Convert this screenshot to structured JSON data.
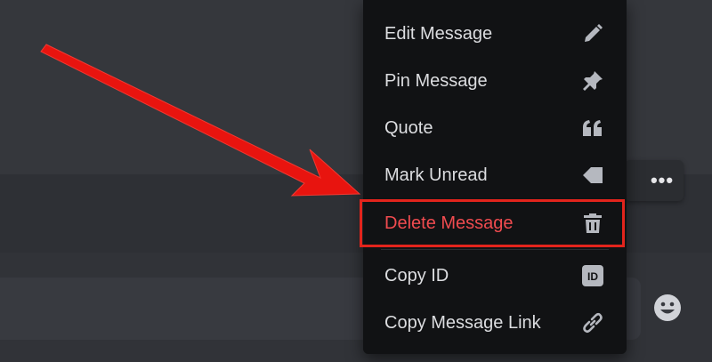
{
  "context_menu": {
    "items": [
      {
        "label": "Edit Message",
        "icon": "pencil-icon"
      },
      {
        "label": "Pin Message",
        "icon": "pin-icon"
      },
      {
        "label": "Quote",
        "icon": "quote-icon"
      },
      {
        "label": "Mark Unread",
        "icon": "mark-unread-icon"
      },
      {
        "label": "Delete Message",
        "icon": "trash-icon"
      },
      {
        "label": "Copy ID",
        "icon": "id-badge-icon"
      },
      {
        "label": "Copy Message Link",
        "icon": "link-icon"
      }
    ]
  },
  "toolbar": {
    "more_label": "•••"
  },
  "colors": {
    "danger": "#f04b4f",
    "highlight": "#e3241c",
    "arrow": "#e8140f",
    "menu_bg": "#111214"
  }
}
